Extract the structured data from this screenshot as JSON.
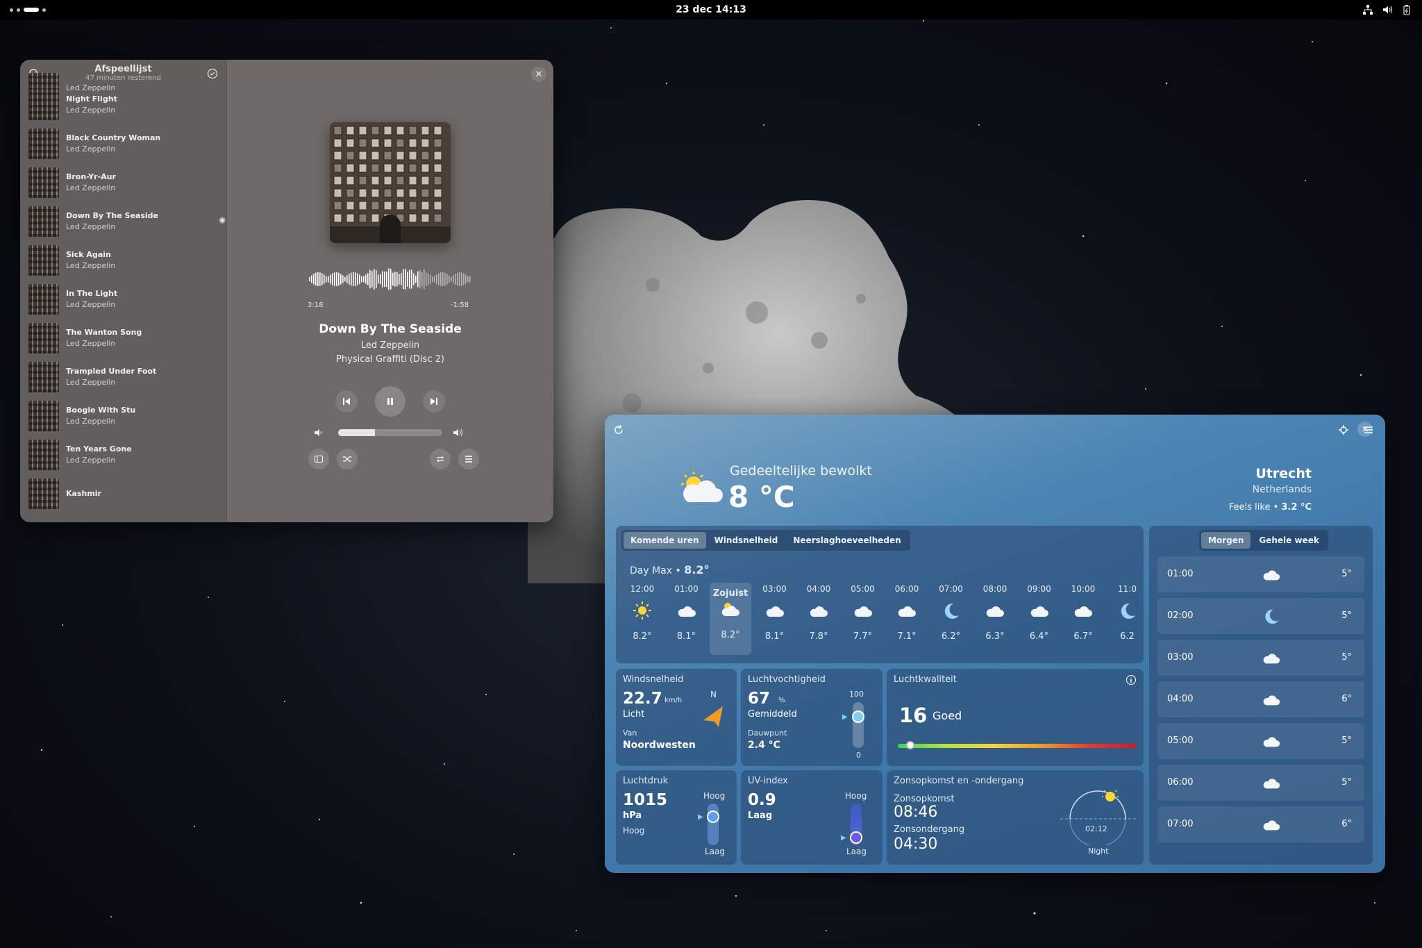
{
  "topbar": {
    "clock": "23 dec  14:13"
  },
  "music": {
    "playlist_title": "Afspeellijst",
    "playlist_subtitle": "47 minuten resterend",
    "tracks": [
      {
        "name": "",
        "artist": "Led Zeppelin"
      },
      {
        "name": "Night Flight",
        "artist": "Led Zeppelin"
      },
      {
        "name": "Black Country Woman",
        "artist": "Led Zeppelin"
      },
      {
        "name": "Bron-Yr-Aur",
        "artist": "Led Zeppelin"
      },
      {
        "name": "Down By The Seaside",
        "artist": "Led Zeppelin"
      },
      {
        "name": "Sick Again",
        "artist": "Led Zeppelin"
      },
      {
        "name": "In The Light",
        "artist": "Led Zeppelin"
      },
      {
        "name": "The Wanton Song",
        "artist": "Led Zeppelin"
      },
      {
        "name": "Trampled Under Foot",
        "artist": "Led Zeppelin"
      },
      {
        "name": "Boogie With Stu",
        "artist": "Led Zeppelin"
      },
      {
        "name": "Ten Years Gone",
        "artist": "Led Zeppelin"
      },
      {
        "name": "Kashmir",
        "artist": ""
      }
    ],
    "now_playing": {
      "title": "Down By The Seaside",
      "artist": "Led Zeppelin",
      "album": "Physical Graffiti (Disc 2)",
      "elapsed": "3:18",
      "remaining": "-1:58",
      "volume_fraction": 0.35
    }
  },
  "weather": {
    "condition": "Gedeeltelijke bewolkt",
    "temperature": "8 °C",
    "city": "Utrecht",
    "country": "Netherlands",
    "feels_like_label": "Feels like •",
    "feels_like_value": "3.2 °C",
    "tabs": [
      "Komende uren",
      "Windsnelheid",
      "Neerslaghoeveelheden"
    ],
    "day_max_label": "Day Max •",
    "day_max_value": "8.2°",
    "hours": [
      {
        "time": "12:00",
        "icon": "sun-icon",
        "temp": "8.2°"
      },
      {
        "time": "01:00",
        "icon": "cloud-icon",
        "temp": "8.1°"
      },
      {
        "time": "Zojuist",
        "icon": "partly-cloudy-icon",
        "temp": "8.2°"
      },
      {
        "time": "03:00",
        "icon": "cloud-icon",
        "temp": "8.1°"
      },
      {
        "time": "04:00",
        "icon": "cloud-icon",
        "temp": "7.8°"
      },
      {
        "time": "05:00",
        "icon": "cloud-icon",
        "temp": "7.7°"
      },
      {
        "time": "06:00",
        "icon": "cloud-icon",
        "temp": "7.1°"
      },
      {
        "time": "07:00",
        "icon": "moon-icon",
        "temp": "6.2°"
      },
      {
        "time": "08:00",
        "icon": "cloud-icon",
        "temp": "6.3°"
      },
      {
        "time": "09:00",
        "icon": "cloud-icon",
        "temp": "6.4°"
      },
      {
        "time": "10:00",
        "icon": "cloud-icon",
        "temp": "6.7°"
      },
      {
        "time": "11:0",
        "icon": "moon-icon",
        "temp": "6.2"
      }
    ],
    "wind": {
      "title": "Windsnelheid",
      "value": "22.7",
      "unit": "km/h",
      "desc": "Licht",
      "from_label": "Van",
      "from": "Noordwesten",
      "north": "N"
    },
    "humidity": {
      "title": "Luchtvochtigheid",
      "value": "67",
      "unit": "%",
      "desc": "Gemiddeld",
      "dew_label": "Dauwpunt",
      "dew": "2.4 °C",
      "max": "100",
      "min": "0"
    },
    "air": {
      "title": "Luchtkwaliteit",
      "value": "16",
      "desc": "Goed"
    },
    "pressure": {
      "title": "Luchtdruk",
      "value": "1015",
      "unit": "hPa",
      "desc": "Hoog",
      "high": "Hoog",
      "low": "Laag"
    },
    "uv": {
      "title": "UV-index",
      "value": "0.9",
      "desc": "Laag",
      "high": "Hoog",
      "low": "Laag"
    },
    "sun": {
      "title": "Zonsopkomst en -ondergang",
      "rise_label": "Zonsopkomst",
      "rise": "08:46",
      "set_label": "Zonsondergang",
      "set": "04:30",
      "dial_time": "02:12",
      "dial_label": "Night"
    },
    "forecast_tabs": [
      "Morgen",
      "Gehele week"
    ],
    "forecast": [
      {
        "time": "01:00",
        "icon": "cloud-icon",
        "temp": "5°"
      },
      {
        "time": "02:00",
        "icon": "moon-icon",
        "temp": "5°"
      },
      {
        "time": "03:00",
        "icon": "cloud-icon",
        "temp": "5°"
      },
      {
        "time": "04:00",
        "icon": "cloud-icon",
        "temp": "6°"
      },
      {
        "time": "05:00",
        "icon": "cloud-icon",
        "temp": "5°"
      },
      {
        "time": "06:00",
        "icon": "cloud-icon",
        "temp": "5°"
      },
      {
        "time": "07:00",
        "icon": "cloud-icon",
        "temp": "6°"
      }
    ]
  }
}
